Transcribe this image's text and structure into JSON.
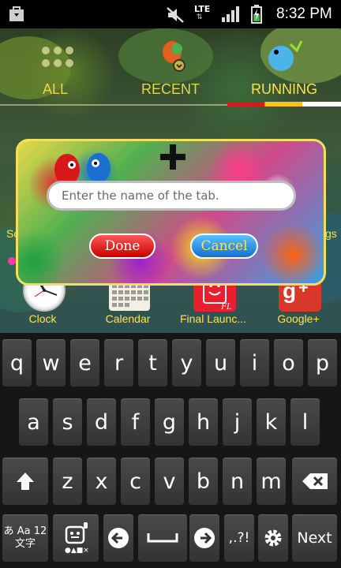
{
  "status_bar": {
    "time": "8:32 PM",
    "network": "LTE",
    "icons": [
      "store-icon",
      "mute-icon",
      "lte-icon",
      "signal-icon",
      "battery-charging-icon"
    ]
  },
  "tabs": [
    {
      "label": "ALL"
    },
    {
      "label": "RECENT"
    },
    {
      "label": "RUNNING",
      "active": true
    }
  ],
  "dialog": {
    "add_icon": "plus-icon",
    "placeholder": "Enter the name of the tab.",
    "value": "",
    "done_label": "Done",
    "cancel_label": "Cancel"
  },
  "dock": [
    {
      "label": "Clock",
      "icon": "clock-icon"
    },
    {
      "label": "Calendar",
      "icon": "calendar-icon"
    },
    {
      "label": "Final Launc...",
      "icon": "final-launcher-icon"
    },
    {
      "label": "Google+",
      "icon": "google-plus-icon"
    }
  ],
  "keyboard": {
    "row1": [
      "q",
      "w",
      "e",
      "r",
      "t",
      "y",
      "u",
      "i",
      "o",
      "p"
    ],
    "row2": [
      "a",
      "s",
      "d",
      "f",
      "g",
      "h",
      "j",
      "k",
      "l"
    ],
    "row3": [
      "z",
      "x",
      "c",
      "v",
      "b",
      "n",
      "m"
    ],
    "mode_key_line1": "あ Aa 12",
    "mode_key_line2": "文字",
    "punct_key": ",.?!",
    "next_label": "Next",
    "icons": [
      "shift-icon",
      "backspace-icon",
      "emoji-icon",
      "left-arrow-icon",
      "space-icon",
      "right-arrow-icon",
      "settings-icon"
    ]
  },
  "colors": {
    "tab_text": "#E8D64A",
    "label_text": "#FFE34A",
    "done_button": "#D81010",
    "cancel_button": "#1E88E5"
  }
}
